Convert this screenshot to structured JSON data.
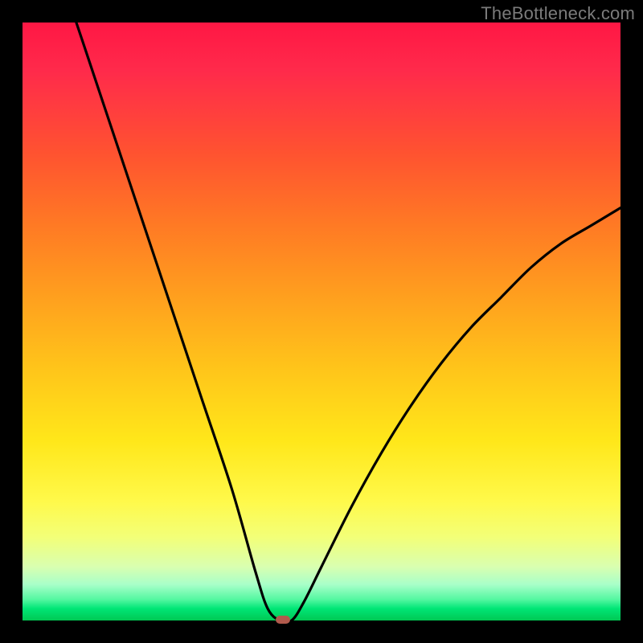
{
  "watermark": "TheBottleneck.com",
  "colors": {
    "frame": "#000000",
    "curve": "#000000",
    "marker": "#b15a4c",
    "gradient_top": "#ff1744",
    "gradient_mid": "#ffe71a",
    "gradient_bottom": "#00c853"
  },
  "chart_data": {
    "type": "line",
    "title": "",
    "xlabel": "",
    "ylabel": "",
    "xlim": [
      0,
      1
    ],
    "ylim": [
      0,
      1
    ],
    "note": "Axes are unlabeled in the source image; x and y are normalized 0–1. y=1 at top (red / high bottleneck), y=0 at bottom (green / balanced). The curve dips to ~0 near x≈0.43 and rises on both sides.",
    "series": [
      {
        "name": "bottleneck-curve",
        "x": [
          0.0,
          0.05,
          0.1,
          0.15,
          0.2,
          0.25,
          0.3,
          0.35,
          0.39,
          0.41,
          0.43,
          0.45,
          0.47,
          0.5,
          0.55,
          0.6,
          0.65,
          0.7,
          0.75,
          0.8,
          0.85,
          0.9,
          0.95,
          1.0
        ],
        "y": [
          1.28,
          1.12,
          0.97,
          0.82,
          0.67,
          0.52,
          0.37,
          0.22,
          0.08,
          0.02,
          0.0,
          0.0,
          0.03,
          0.09,
          0.19,
          0.28,
          0.36,
          0.43,
          0.49,
          0.54,
          0.59,
          0.63,
          0.66,
          0.69
        ]
      }
    ],
    "marker": {
      "x": 0.435,
      "y": 0.0
    }
  }
}
